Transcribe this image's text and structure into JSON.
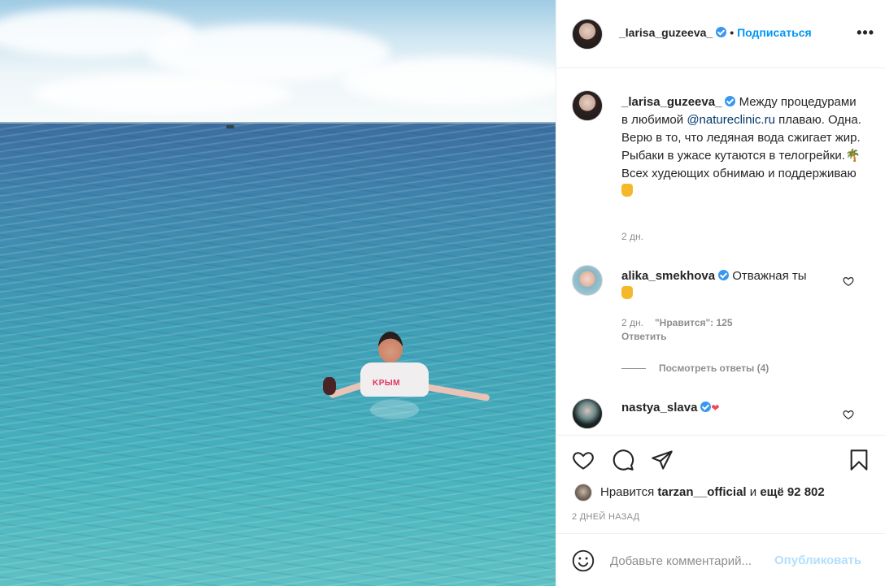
{
  "post": {
    "username": "_larisa_guzeeva_",
    "separator": "•",
    "follow_label": "Подписаться",
    "more_label": "•••",
    "photo": {
      "shirt_text": "KPЫM"
    },
    "caption": {
      "username": "_larisa_guzeeva_",
      "text_1": "Между процедурами в любимой ",
      "mention": "@natureclinic.ru",
      "text_2": " плаваю. Одна. Верю в то, что ледяная вода сжигает жир. Рыбаки в ужасе кутаются в телогрейки.",
      "text_3": "Всех худеющих обнимаю и поддерживаю",
      "time": "2 дн."
    },
    "comments": [
      {
        "username": "alika_smekhova",
        "text": "Отважная ты",
        "time": "2 дн.",
        "likes_label": "\"Нравится\": 125",
        "reply_label": "Ответить",
        "view_replies_label": "Посмотреть ответы (4)"
      },
      {
        "username": "nastya_slava"
      }
    ],
    "likes": {
      "prefix": "Нравится",
      "user": "tarzan__official",
      "connector": "и",
      "count_text": "ещё 92 802"
    },
    "date": "2 ДНЕЙ НАЗАД",
    "add_comment": {
      "placeholder": "Добавьте комментарий...",
      "publish_label": "Опубликовать"
    },
    "colors": {
      "accent": "#0095f6",
      "verified": "#3897f0",
      "muted": "#8e8e8e",
      "publish_disabled": "#b2dffc"
    },
    "icons": [
      "heart-icon",
      "comment-icon",
      "share-icon",
      "bookmark-icon",
      "smile-icon",
      "verified-badge-icon"
    ]
  }
}
